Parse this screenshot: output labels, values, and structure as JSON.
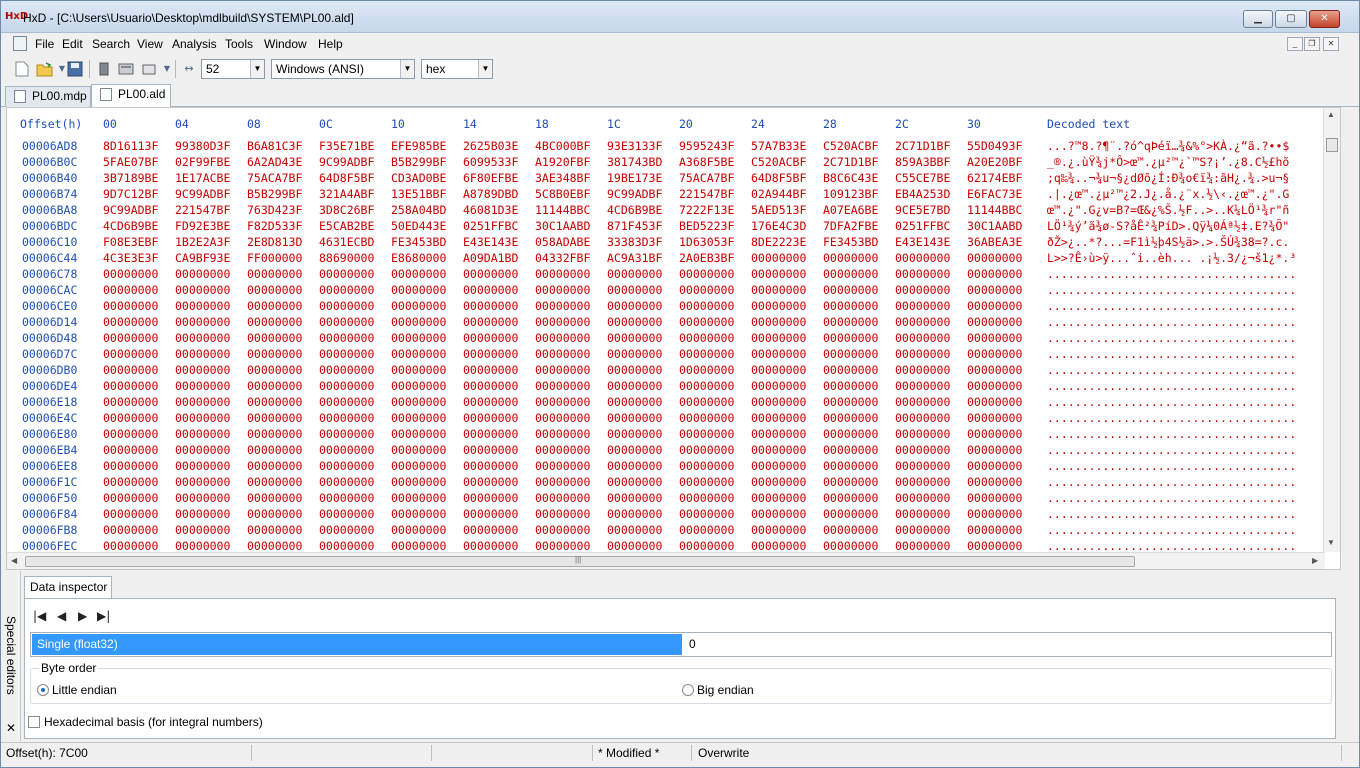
{
  "window": {
    "title": "HxD - [C:\\Users\\Usuario\\Desktop\\mdlbuild\\SYSTEM\\PL00.ald]",
    "app_icon_label": "HxD",
    "min_glyph": "▁",
    "max_glyph": "▢",
    "close_glyph": "✕"
  },
  "menu": [
    "File",
    "Edit",
    "Search",
    "View",
    "Analysis",
    "Tools",
    "Window",
    "Help"
  ],
  "mdi_controls": {
    "minimize": "_",
    "restore": "❐",
    "close": "✕"
  },
  "toolbar": {
    "icons": [
      "new-file",
      "open-file",
      "dropdown-arrow",
      "save",
      "file-properties",
      "open-disk",
      "open-ram",
      "dropdown-arrow",
      "bytes-per-row"
    ],
    "bytes_per_row": "52",
    "charset": "Windows (ANSI)",
    "offset_base": "hex"
  },
  "tabs": [
    {
      "label": "PL00.mdp",
      "active": false
    },
    {
      "label": "PL00.ald",
      "active": true
    }
  ],
  "hex": {
    "offset_header": "Offset(h)",
    "columns": [
      "00",
      "04",
      "08",
      "0C",
      "10",
      "14",
      "18",
      "1C",
      "20",
      "24",
      "28",
      "2C",
      "30"
    ],
    "decoded_header": "Decoded text",
    "rows": [
      {
        "offset": "00006AD8",
        "cells": [
          "8D16113F",
          "99380D3F",
          "B6A81C3F",
          "F35E71BE",
          "EFE985BE",
          "2625B03E",
          "4BC000BF",
          "93E3133F",
          "9595243F",
          "57A7B33E",
          "C520ACBF",
          "2C71D1BF",
          "55D0493F"
        ],
        "text": "...?™8.?¶¨.?ó^qÞéï…¾&%°>KÀ.¿“ã.?••$"
      },
      {
        "offset": "00006B0C",
        "cells": [
          "5FAE07BF",
          "02F99FBE",
          "6A2AD43E",
          "9C99ADBF",
          "B5B299BF",
          "6099533F",
          "A1920FBF",
          "381743BD",
          "A368F5BE",
          "C520ACBF",
          "2C71D1BF",
          "859A3BBF",
          "A20E20BF"
        ],
        "text": "_®.¿.ùŸ¾j*Ô>œ™.¿µ²™¿`™S?¡’.¿8.C½£hõ"
      },
      {
        "offset": "00006B40",
        "cells": [
          "3B7189BE",
          "1E17ACBE",
          "75ACA7BF",
          "64D8F5BF",
          "CD3AD0BE",
          "6F80EFBE",
          "3AE348BF",
          "19BE173E",
          "75ACA7BF",
          "64D8F5BF",
          "B8C6C43E",
          "C55CE7BE",
          "62174EBF"
        ],
        "text": ";q‰¾..¬¾u¬§¿dØõ¿Í:Ð¾o€ï¾:ãH¿.¾.>u¬§"
      },
      {
        "offset": "00006B74",
        "cells": [
          "9D7C12BF",
          "9C99ADBF",
          "B5B299BF",
          "321A4ABF",
          "13E51BBF",
          "A8789DBD",
          "5C8B0EBF",
          "9C99ADBF",
          "221547BF",
          "02A944BF",
          "109123BF",
          "EB4A253D",
          "E6FAC73E"
        ],
        "text": ".|.¿œ™.¿µ²™¿2.J¿.å.¿¨x.½\\‹.¿œ™.¿\".G"
      },
      {
        "offset": "00006BA8",
        "cells": [
          "9C99ADBF",
          "221547BF",
          "763D423F",
          "3D8C26BF",
          "258A04BD",
          "46081D3E",
          "11144BBC",
          "4CD6B9BE",
          "7222F13E",
          "5AED513F",
          "A07EA6BE",
          "9CE5E7BD",
          "11144BBC"
        ],
        "text": "œ™.¿\".G¿v=B?=Œ&¿%Š.½F..>..K¼LÖ¹¾r\"ñ"
      },
      {
        "offset": "00006BDC",
        "cells": [
          "4CD6B9BE",
          "FD92E3BE",
          "F82D533F",
          "E5CAB2BE",
          "50ED443E",
          "0251FFBC",
          "30C1AABD",
          "871F453F",
          "BED5223F",
          "176E4C3D",
          "7DFA2FBE",
          "0251FFBC",
          "30C1AABD"
        ],
        "text": "LÖ¹¾ý’ã¾ø-S?åÊ²¾PíD>.Qÿ¼0Áª½‡.E?¾Õ\""
      },
      {
        "offset": "00006C10",
        "cells": [
          "F08E3EBF",
          "1B2E2A3F",
          "2E8D813D",
          "4631ECBD",
          "FE3453BD",
          "E43E143E",
          "058ADABE",
          "33383D3F",
          "1D63053F",
          "8DE2223E",
          "FE3453BD",
          "E43E143E",
          "36ABEA3E"
        ],
        "text": "ðŽ>¿..*?...=F1ì½þ4S½ä>.>.ŠÚ¾38=?.c."
      },
      {
        "offset": "00006C44",
        "cells": [
          "4C3E3E3F",
          "CA9BF93E",
          "FF000000",
          "88690000",
          "E8680000",
          "A09DA1BD",
          "04332FBF",
          "AC9A31BF",
          "2A0EB3BF",
          "00000000",
          "00000000",
          "00000000",
          "00000000"
        ],
        "text": "L>>?Ê›ù>ÿ...ˆi..èh... .¡½.3/¿¬š1¿*.³"
      },
      {
        "offset": "00006C78",
        "cells": [
          "00000000",
          "00000000",
          "00000000",
          "00000000",
          "00000000",
          "00000000",
          "00000000",
          "00000000",
          "00000000",
          "00000000",
          "00000000",
          "00000000",
          "00000000"
        ],
        "text": "...................................."
      },
      {
        "offset": "00006CAC",
        "cells": [
          "00000000",
          "00000000",
          "00000000",
          "00000000",
          "00000000",
          "00000000",
          "00000000",
          "00000000",
          "00000000",
          "00000000",
          "00000000",
          "00000000",
          "00000000"
        ],
        "text": "...................................."
      },
      {
        "offset": "00006CE0",
        "cells": [
          "00000000",
          "00000000",
          "00000000",
          "00000000",
          "00000000",
          "00000000",
          "00000000",
          "00000000",
          "00000000",
          "00000000",
          "00000000",
          "00000000",
          "00000000"
        ],
        "text": "...................................."
      },
      {
        "offset": "00006D14",
        "cells": [
          "00000000",
          "00000000",
          "00000000",
          "00000000",
          "00000000",
          "00000000",
          "00000000",
          "00000000",
          "00000000",
          "00000000",
          "00000000",
          "00000000",
          "00000000"
        ],
        "text": "...................................."
      },
      {
        "offset": "00006D48",
        "cells": [
          "00000000",
          "00000000",
          "00000000",
          "00000000",
          "00000000",
          "00000000",
          "00000000",
          "00000000",
          "00000000",
          "00000000",
          "00000000",
          "00000000",
          "00000000"
        ],
        "text": "...................................."
      },
      {
        "offset": "00006D7C",
        "cells": [
          "00000000",
          "00000000",
          "00000000",
          "00000000",
          "00000000",
          "00000000",
          "00000000",
          "00000000",
          "00000000",
          "00000000",
          "00000000",
          "00000000",
          "00000000"
        ],
        "text": "...................................."
      },
      {
        "offset": "00006DB0",
        "cells": [
          "00000000",
          "00000000",
          "00000000",
          "00000000",
          "00000000",
          "00000000",
          "00000000",
          "00000000",
          "00000000",
          "00000000",
          "00000000",
          "00000000",
          "00000000"
        ],
        "text": "...................................."
      },
      {
        "offset": "00006DE4",
        "cells": [
          "00000000",
          "00000000",
          "00000000",
          "00000000",
          "00000000",
          "00000000",
          "00000000",
          "00000000",
          "00000000",
          "00000000",
          "00000000",
          "00000000",
          "00000000"
        ],
        "text": "...................................."
      },
      {
        "offset": "00006E18",
        "cells": [
          "00000000",
          "00000000",
          "00000000",
          "00000000",
          "00000000",
          "00000000",
          "00000000",
          "00000000",
          "00000000",
          "00000000",
          "00000000",
          "00000000",
          "00000000"
        ],
        "text": "...................................."
      },
      {
        "offset": "00006E4C",
        "cells": [
          "00000000",
          "00000000",
          "00000000",
          "00000000",
          "00000000",
          "00000000",
          "00000000",
          "00000000",
          "00000000",
          "00000000",
          "00000000",
          "00000000",
          "00000000"
        ],
        "text": "...................................."
      },
      {
        "offset": "00006E80",
        "cells": [
          "00000000",
          "00000000",
          "00000000",
          "00000000",
          "00000000",
          "00000000",
          "00000000",
          "00000000",
          "00000000",
          "00000000",
          "00000000",
          "00000000",
          "00000000"
        ],
        "text": "...................................."
      },
      {
        "offset": "00006EB4",
        "cells": [
          "00000000",
          "00000000",
          "00000000",
          "00000000",
          "00000000",
          "00000000",
          "00000000",
          "00000000",
          "00000000",
          "00000000",
          "00000000",
          "00000000",
          "00000000"
        ],
        "text": "...................................."
      },
      {
        "offset": "00006EE8",
        "cells": [
          "00000000",
          "00000000",
          "00000000",
          "00000000",
          "00000000",
          "00000000",
          "00000000",
          "00000000",
          "00000000",
          "00000000",
          "00000000",
          "00000000",
          "00000000"
        ],
        "text": "...................................."
      },
      {
        "offset": "00006F1C",
        "cells": [
          "00000000",
          "00000000",
          "00000000",
          "00000000",
          "00000000",
          "00000000",
          "00000000",
          "00000000",
          "00000000",
          "00000000",
          "00000000",
          "00000000",
          "00000000"
        ],
        "text": "...................................."
      },
      {
        "offset": "00006F50",
        "cells": [
          "00000000",
          "00000000",
          "00000000",
          "00000000",
          "00000000",
          "00000000",
          "00000000",
          "00000000",
          "00000000",
          "00000000",
          "00000000",
          "00000000",
          "00000000"
        ],
        "text": "...................................."
      },
      {
        "offset": "00006F84",
        "cells": [
          "00000000",
          "00000000",
          "00000000",
          "00000000",
          "00000000",
          "00000000",
          "00000000",
          "00000000",
          "00000000",
          "00000000",
          "00000000",
          "00000000",
          "00000000"
        ],
        "text": "...................................."
      },
      {
        "offset": "00006FB8",
        "cells": [
          "00000000",
          "00000000",
          "00000000",
          "00000000",
          "00000000",
          "00000000",
          "00000000",
          "00000000",
          "00000000",
          "00000000",
          "00000000",
          "00000000",
          "00000000"
        ],
        "text": "...................................."
      },
      {
        "offset": "00006FEC",
        "cells": [
          "00000000",
          "00000000",
          "00000000",
          "00000000",
          "00000000",
          "00000000",
          "00000000",
          "00000000",
          "00000000",
          "00000000",
          "00000000",
          "00000000",
          "00000000"
        ],
        "text": "...................................."
      }
    ]
  },
  "side_panel": {
    "label": "Special editors",
    "close": "✕"
  },
  "inspector": {
    "tab": "Data inspector",
    "nav": [
      "|◀",
      "◀",
      "▶",
      "▶|"
    ],
    "data_type": "Single (float32)",
    "data_value": "0",
    "byte_order_label": "Byte order",
    "little_endian": "Little endian",
    "big_endian": "Big endian",
    "hex_basis": "Hexadecimal basis (for integral numbers)"
  },
  "status": {
    "offset": "Offset(h): 7C00",
    "modified": "* Modified *",
    "mode": "Overwrite"
  },
  "colors": {
    "offset_blue": "#1d4fb5",
    "byte_red": "#c80000",
    "selection_blue": "#3399ff"
  }
}
